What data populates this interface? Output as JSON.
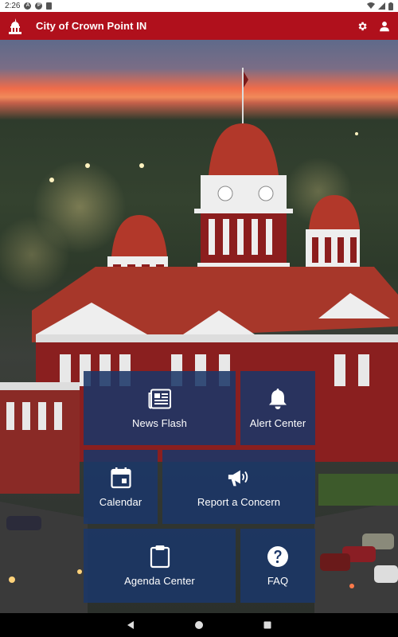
{
  "status_bar": {
    "time": "2:26",
    "icons": [
      "a-icon",
      "p-icon",
      "sim-card-icon"
    ],
    "right_icons": [
      "wifi-icon",
      "signal-icon",
      "battery-icon"
    ]
  },
  "app_bar": {
    "title": "City of Crown Point IN",
    "color": "#b0101c",
    "actions": [
      "settings-gear-icon",
      "account-person-icon"
    ]
  },
  "tiles": [
    {
      "label": "News Flash",
      "icon": "newspaper-icon"
    },
    {
      "label": "Alert Center",
      "icon": "bell-icon"
    },
    {
      "label": "Calendar",
      "icon": "calendar-icon"
    },
    {
      "label": "Report a Concern",
      "icon": "megaphone-icon"
    },
    {
      "label": "Agenda Center",
      "icon": "clipboard-icon"
    },
    {
      "label": "FAQ",
      "icon": "question-circle-icon"
    }
  ],
  "tile_color": "#1b3768",
  "nav_bar": [
    "back-icon",
    "home-icon",
    "recents-icon"
  ]
}
